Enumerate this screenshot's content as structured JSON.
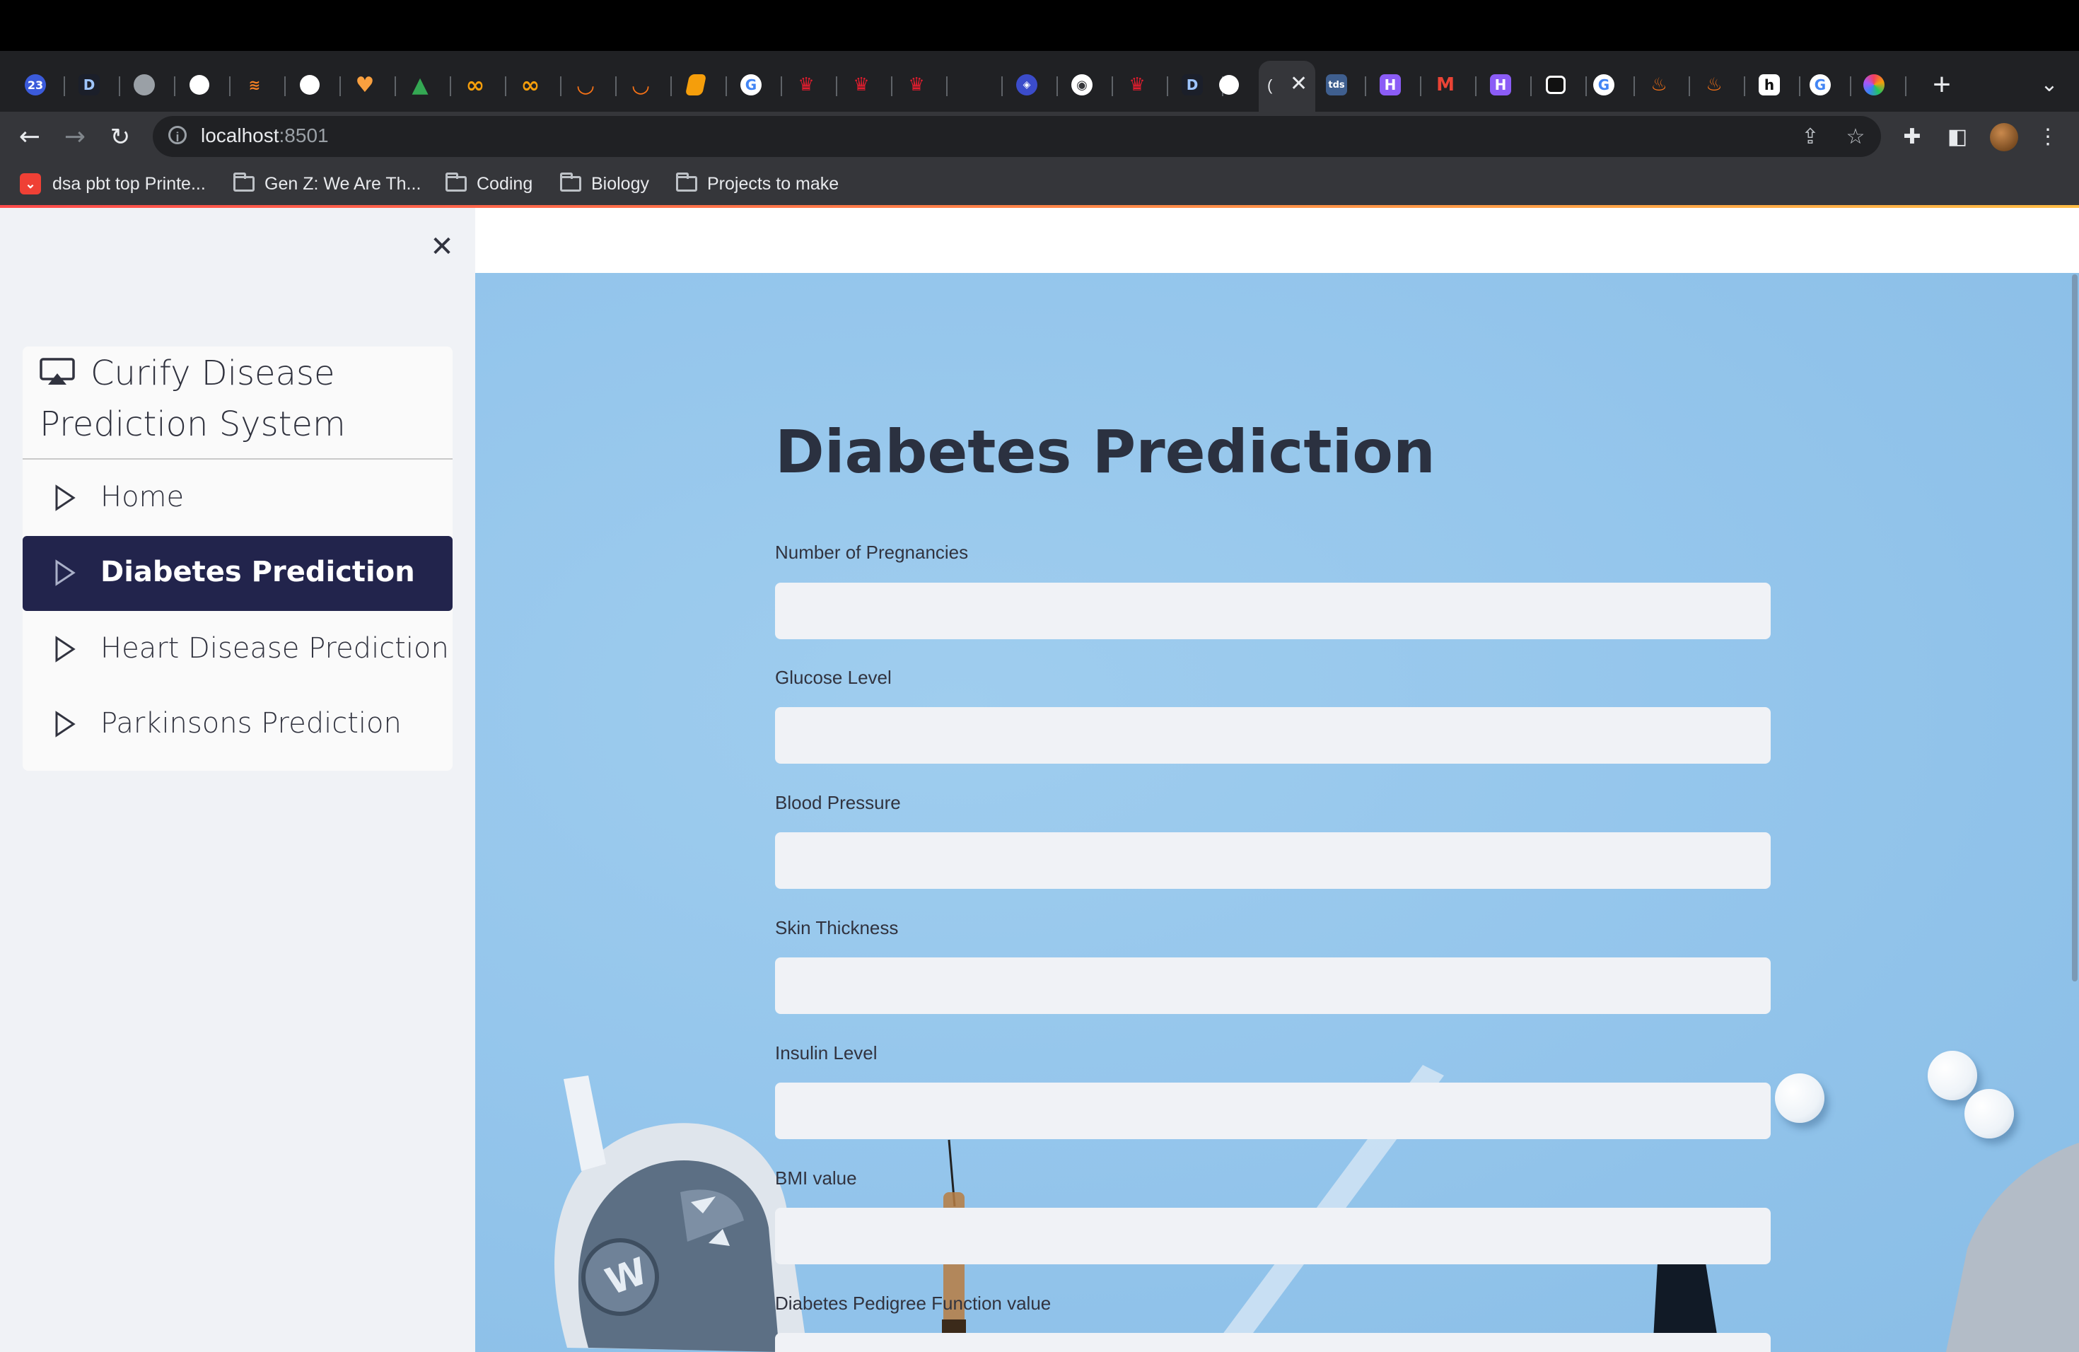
{
  "browser": {
    "tabs_favicons": [
      "calendar-icon",
      "d-icon",
      "globe-icon",
      "github-icon",
      "stackoverflow-icon",
      "github-icon",
      "heart-icon",
      "drive-icon",
      "infinity-icon",
      "infinity-icon",
      "arc-icon",
      "arc-icon",
      "book-icon",
      "google-icon",
      "crown-icon",
      "crown-icon",
      "crown-icon",
      "blank-icon",
      "shield-icon",
      "chrome-icon",
      "crown-icon",
      "d-icon",
      "github-icon"
    ],
    "tabs_favicons_right": [
      "tds-icon",
      "h-icon",
      "gmail-icon",
      "h-icon",
      "box-icon",
      "google-icon",
      "flame-icon",
      "flame-icon",
      "notion-icon",
      "google-icon",
      "hexagon-icon"
    ],
    "calendar_badge": "23",
    "tds_badge": "tds",
    "new_tab": "+",
    "active_tab_close": "✕",
    "url_host": "localhost",
    "url_port": ":8501",
    "bookmarks": [
      {
        "label": "dsa pbt top Printe...",
        "type": "page"
      },
      {
        "label": "Gen Z: We Are Th...",
        "type": "folder"
      },
      {
        "label": "Coding",
        "type": "folder"
      },
      {
        "label": "Biology",
        "type": "folder"
      },
      {
        "label": "Projects to make",
        "type": "folder"
      }
    ]
  },
  "sidebar": {
    "close_icon": "✕",
    "menu_title": "Curify Disease Prediction System",
    "items": [
      {
        "label": "Home",
        "active": false
      },
      {
        "label": "Diabetes Prediction",
        "active": true
      },
      {
        "label": "Heart Disease Prediction",
        "active": false
      },
      {
        "label": "Parkinsons Prediction",
        "active": false
      }
    ],
    "accent_color": "#22244c"
  },
  "main": {
    "title": "Diabetes Prediction",
    "fields": [
      {
        "label": "Number of Pregnancies",
        "value": ""
      },
      {
        "label": "Glucose Level",
        "value": ""
      },
      {
        "label": "Blood Pressure",
        "value": ""
      },
      {
        "label": "Skin Thickness",
        "value": ""
      },
      {
        "label": "Insulin Level",
        "value": ""
      },
      {
        "label": "BMI value",
        "value": ""
      },
      {
        "label": "Diabetes Pedigree Function value",
        "value": ""
      }
    ],
    "background_color": "#95c6ec",
    "meter_button_letter": "W"
  }
}
